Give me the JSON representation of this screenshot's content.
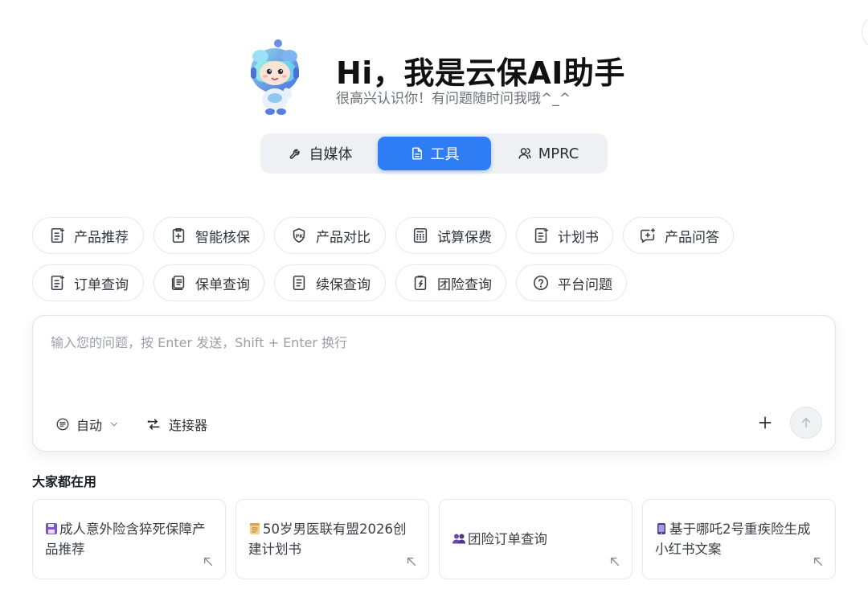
{
  "hero": {
    "title": "Hi，我是云保AI助手",
    "subtitle": "很高兴认识你！有问题随时问我哦^_^"
  },
  "mode_tabs": [
    {
      "label": "自媒体",
      "icon": "wrench-icon",
      "active": false
    },
    {
      "label": "工具",
      "icon": "document-icon",
      "active": true
    },
    {
      "label": "MPRC",
      "icon": "people-icon",
      "active": false
    }
  ],
  "tools": [
    {
      "label": "产品推荐",
      "icon": "doc-list-icon"
    },
    {
      "label": "智能核保",
      "icon": "clipboard-plus-icon"
    },
    {
      "label": "产品对比",
      "icon": "pk-shield-icon"
    },
    {
      "label": "试算保费",
      "icon": "calculator-icon"
    },
    {
      "label": "计划书",
      "icon": "doc-list-icon"
    },
    {
      "label": "产品问答",
      "icon": "chat-plus-icon"
    },
    {
      "label": "订单查询",
      "icon": "doc-list-icon"
    },
    {
      "label": "保单查询",
      "icon": "policy-icon"
    },
    {
      "label": "续保查询",
      "icon": "doc-list-icon"
    },
    {
      "label": "团险查询",
      "icon": "team-doc-icon"
    },
    {
      "label": "平台问题",
      "icon": "question-circle-icon"
    }
  ],
  "input": {
    "placeholder": "输入您的问题，按 Enter 发送，Shift + Enter 换行",
    "value": "",
    "mode_label": "自动",
    "connector_label": "连接器"
  },
  "popular": {
    "title": "大家都在用",
    "cards": [
      {
        "text": "成人意外险含猝死保障产品推荐",
        "icon": "floppy-icon",
        "icon_color": "#7a56c9"
      },
      {
        "text": "50岁男医联有盟2026创建计划书",
        "icon": "notepad-icon",
        "icon_color": "#e0a53a"
      },
      {
        "text": "团险订单查询",
        "icon": "two-people-icon",
        "icon_color": "#6a4aa8"
      },
      {
        "text": "基于哪吒2号重疾险生成小红书文案",
        "icon": "phone-icon",
        "icon_color": "#4b3a8a"
      }
    ]
  },
  "colors": {
    "accent": "#2e7df5",
    "chip_border": "#e6e8ec",
    "tab_bg": "#eff0f3"
  }
}
